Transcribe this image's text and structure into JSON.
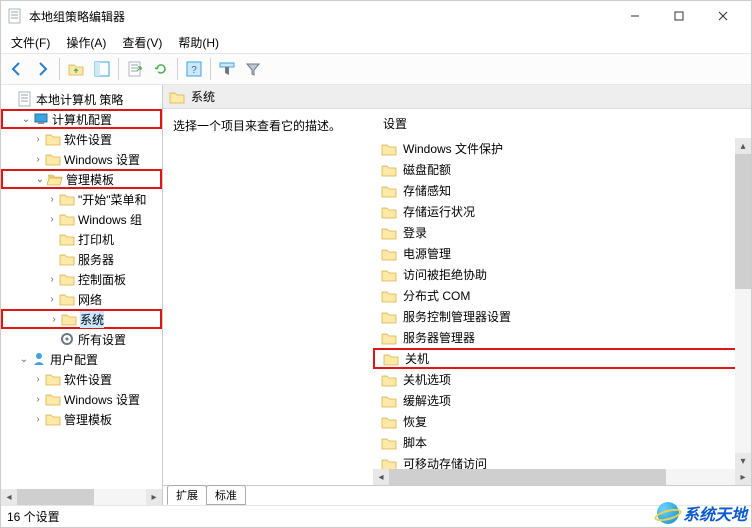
{
  "window": {
    "title": "本地组策略编辑器"
  },
  "menus": {
    "file": "文件(F)",
    "action": "操作(A)",
    "view": "查看(V)",
    "help": "帮助(H)"
  },
  "tree": {
    "root": "本地计算机 策略",
    "computer_config": "计算机配置",
    "software_settings": "软件设置",
    "windows_settings": "Windows 设置",
    "admin_templates": "管理模板",
    "start_menu": "\"开始\"菜单和",
    "windows_comp": "Windows 组",
    "printers": "打印机",
    "servers": "服务器",
    "control_panel": "控制面板",
    "network": "网络",
    "system": "系统",
    "all_settings": "所有设置",
    "user_config": "用户配置",
    "u_software_settings": "软件设置",
    "u_windows_settings": "Windows 设置",
    "u_admin_templates": "管理模板"
  },
  "content": {
    "path_label": "系统",
    "description_hint": "选择一个项目来查看它的描述。",
    "settings_header": "设置",
    "items": {
      "0": "Windows 文件保护",
      "1": "磁盘配额",
      "2": "存储感知",
      "3": "存储运行状况",
      "4": "登录",
      "5": "电源管理",
      "6": "访问被拒绝协助",
      "7": "分布式 COM",
      "8": "服务控制管理器设置",
      "9": "服务器管理器",
      "10": "关机",
      "11": "关机选项",
      "12": "缓解选项",
      "13": "恢复",
      "14": "脚本",
      "15": "可移动存储访问"
    }
  },
  "tabs": {
    "extended": "扩展",
    "standard": "标准"
  },
  "status": {
    "count": "16 个设置"
  },
  "watermark": "系统天地"
}
